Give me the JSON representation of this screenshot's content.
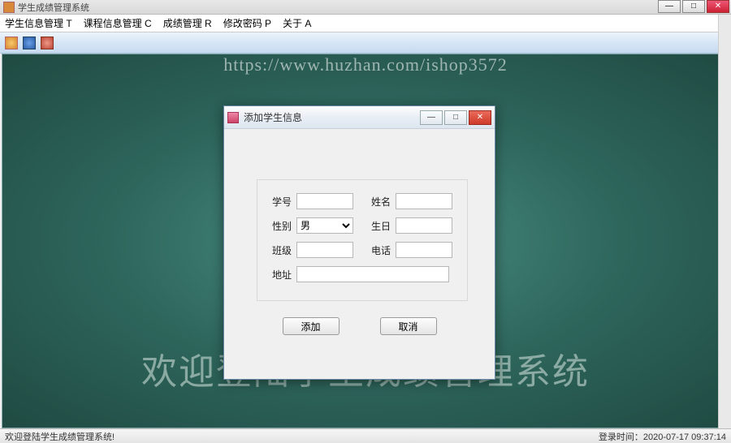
{
  "window": {
    "title": "学生成绩管理系统"
  },
  "menu": {
    "student": "学生信息管理 T",
    "course": "课程信息管理 C",
    "grade": "成绩管理 R",
    "password": "修改密码 P",
    "about": "关于 A"
  },
  "watermark": {
    "url": "https://www.huzhan.com/ishop3572",
    "welcome": "欢迎登陆学生成绩管理系统"
  },
  "dialog": {
    "title": "添加学生信息",
    "labels": {
      "sno": "学号",
      "name": "姓名",
      "gender": "性别",
      "birthday": "生日",
      "class": "班级",
      "phone": "电话",
      "address": "地址"
    },
    "values": {
      "sno": "",
      "name": "",
      "gender": "男",
      "birthday": "",
      "class": "",
      "phone": "",
      "address": ""
    },
    "buttons": {
      "add": "添加",
      "cancel": "取消"
    },
    "win": {
      "min": "—",
      "max": "□",
      "close": "✕"
    }
  },
  "status": {
    "left": "欢迎登陆学生成绩管理系统!",
    "right_label": "登录时间：",
    "right_time": "2020-07-17 09:37:14"
  }
}
